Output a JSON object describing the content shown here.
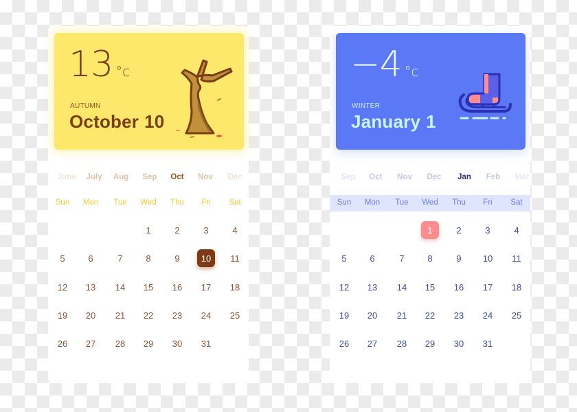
{
  "calendars": [
    {
      "id": "autumn",
      "temperature": "13",
      "unit": "°c",
      "season": "AUTUMN",
      "month_name": "October",
      "day": "10",
      "illustration": "bare-tree-icon",
      "colors": {
        "accent": "#fde86c",
        "text": "#7a3d14",
        "selected": "#7e3a15"
      },
      "months": [
        {
          "label": "June",
          "color": "#f3e4d3"
        },
        {
          "label": "July",
          "color": "#dcc3a6"
        },
        {
          "label": "Aug",
          "color": "#dcc3a6"
        },
        {
          "label": "Sep",
          "color": "#dcc3a6"
        },
        {
          "label": "Oct",
          "color": "#9a5513",
          "active": true
        },
        {
          "label": "Nov",
          "color": "#dcc3a6"
        },
        {
          "label": "Dec",
          "color": "#f0e3d6"
        }
      ],
      "weekdays": [
        "Sun",
        "Mon",
        "Tue",
        "Wed",
        "Thu",
        "Fri",
        "Sat"
      ],
      "first_weekday": 3,
      "days_in_month": 31,
      "selected_day": 10
    },
    {
      "id": "winter",
      "temperature": "−4",
      "unit": "°c",
      "season": "WINTER",
      "month_name": "January",
      "day": "1",
      "illustration": "ice-skate-sled-icon",
      "colors": {
        "accent": "#5b78f6",
        "text": "#c9f5ee",
        "selected": "#ff8d90"
      },
      "months": [
        {
          "label": "Sep",
          "color": "#e3e6f7"
        },
        {
          "label": "Oct",
          "color": "#c3c8e6"
        },
        {
          "label": "Nov",
          "color": "#c3c8e6"
        },
        {
          "label": "Dec",
          "color": "#c3c8e6"
        },
        {
          "label": "Jan",
          "color": "#27337f",
          "active": true
        },
        {
          "label": "Feb",
          "color": "#c3c8e6"
        },
        {
          "label": "Mar",
          "color": "#e8eaf7"
        }
      ],
      "weekdays": [
        "Sun",
        "Mon",
        "Tue",
        "Wed",
        "Thu",
        "Fri",
        "Sat"
      ],
      "first_weekday": 3,
      "days_in_month": 31,
      "selected_day": 1
    }
  ]
}
